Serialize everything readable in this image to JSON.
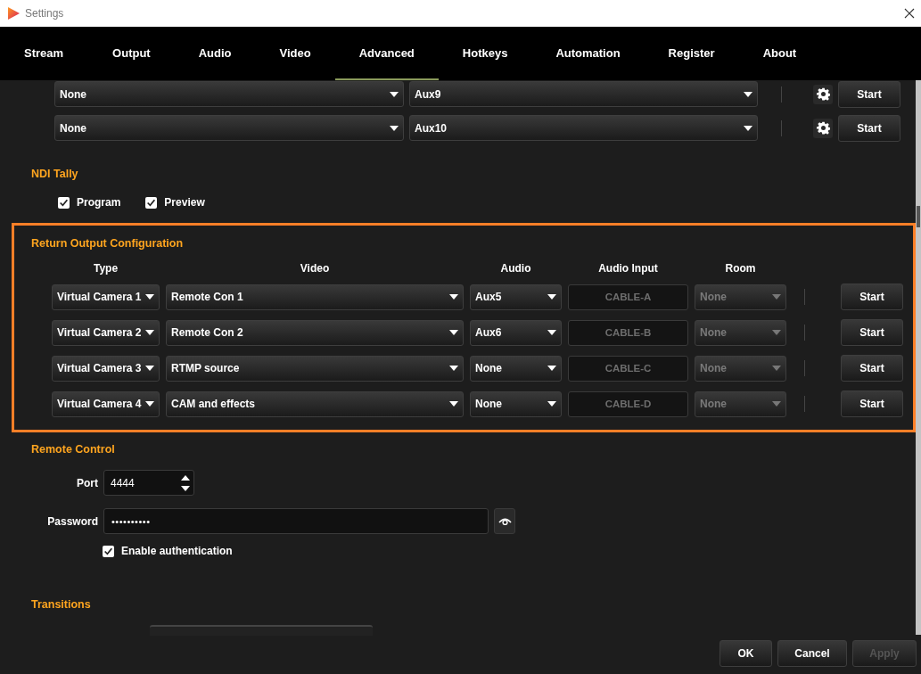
{
  "window": {
    "title": "Settings"
  },
  "tabs": [
    {
      "label": "Stream",
      "selected": false
    },
    {
      "label": "Output",
      "selected": false
    },
    {
      "label": "Audio",
      "selected": false
    },
    {
      "label": "Video",
      "selected": false
    },
    {
      "label": "Advanced",
      "selected": true
    },
    {
      "label": "Hotkeys",
      "selected": false
    },
    {
      "label": "Automation",
      "selected": false
    },
    {
      "label": "Register",
      "selected": false
    },
    {
      "label": "About",
      "selected": false
    }
  ],
  "aux_outputs": [
    {
      "source": "None",
      "output": "Aux9",
      "button": "Start"
    },
    {
      "source": "None",
      "output": "Aux10",
      "button": "Start"
    }
  ],
  "ndi_tally": {
    "heading": "NDI Tally",
    "options": [
      {
        "label": "Program",
        "checked": true
      },
      {
        "label": "Preview",
        "checked": true
      }
    ]
  },
  "return_output": {
    "heading": "Return Output Configuration",
    "columns": [
      "Type",
      "Video",
      "Audio",
      "Audio Input",
      "Room"
    ],
    "rows": [
      {
        "type": "Virtual Camera 1",
        "video": "Remote Con 1",
        "audio": "Aux5",
        "audio_input": {
          "value": "CABLE-A",
          "disabled": true
        },
        "room": {
          "value": "None",
          "disabled": true
        },
        "button": "Start"
      },
      {
        "type": "Virtual Camera 2",
        "video": "Remote Con 2",
        "audio": "Aux6",
        "audio_input": {
          "value": "CABLE-B",
          "disabled": true
        },
        "room": {
          "value": "None",
          "disabled": true
        },
        "button": "Start"
      },
      {
        "type": "Virtual Camera 3",
        "video": "RTMP source",
        "audio": "None",
        "audio_input": {
          "value": "CABLE-C",
          "disabled": true
        },
        "room": {
          "value": "None",
          "disabled": true
        },
        "button": "Start"
      },
      {
        "type": "Virtual Camera 4",
        "video": "CAM and effects",
        "audio": "None",
        "audio_input": {
          "value": "CABLE-D",
          "disabled": true
        },
        "room": {
          "value": "None",
          "disabled": true
        },
        "button": "Start"
      }
    ]
  },
  "remote_control": {
    "heading": "Remote Control",
    "port": {
      "label": "Port",
      "value": "4444"
    },
    "password": {
      "label": "Password",
      "value": "••••••••••"
    },
    "authentication": {
      "label": "Enable authentication",
      "checked": true
    }
  },
  "transitions": {
    "heading": "Transitions"
  },
  "buttons": [
    {
      "label": "OK",
      "disabled": false
    },
    {
      "label": "Cancel",
      "disabled": false
    },
    {
      "label": "Apply",
      "disabled": true
    }
  ]
}
